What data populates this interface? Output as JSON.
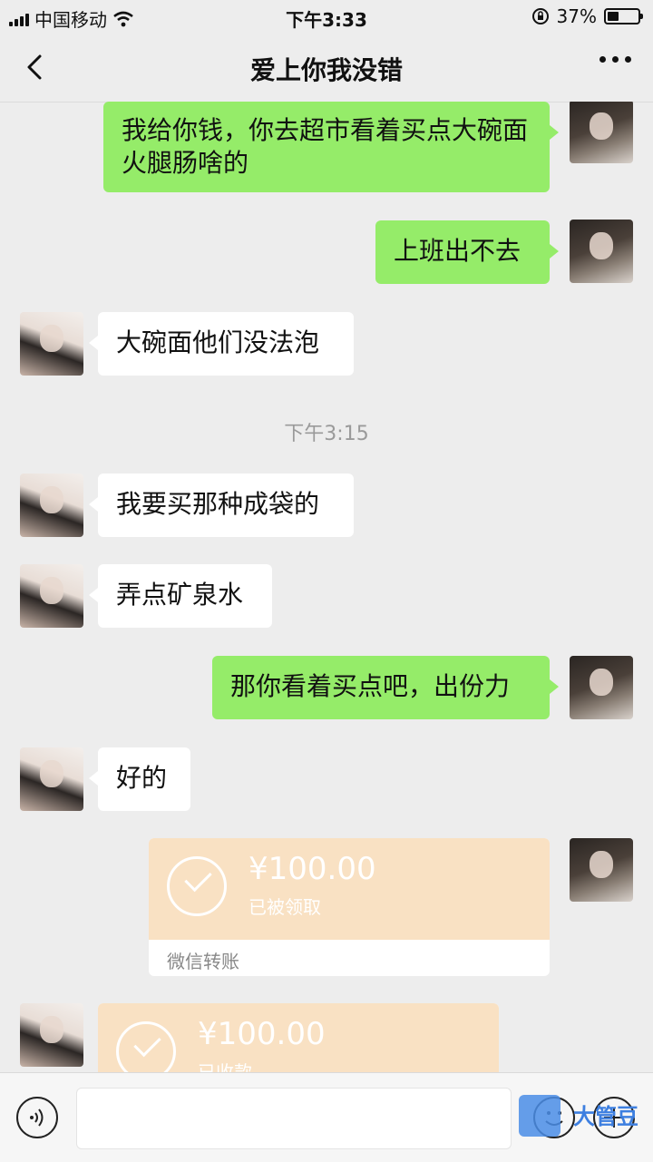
{
  "status_bar": {
    "carrier": "中国移动",
    "time": "下午3:33",
    "battery_percent": "37%",
    "battery_level": 0.37
  },
  "header": {
    "title": "爱上你我没错"
  },
  "messages": [
    {
      "side": "right",
      "text": "我给你钱，你去超市看着买点大碗面火腿肠啥的"
    },
    {
      "side": "right",
      "text": "上班出不去"
    },
    {
      "side": "left",
      "text": "大碗面他们没法泡"
    },
    {
      "side": "left",
      "text": "我要买那种成袋的"
    },
    {
      "side": "left",
      "text": "弄点矿泉水"
    },
    {
      "side": "right",
      "text": "那你看着买点吧，出份力"
    },
    {
      "side": "left",
      "text": "好的"
    }
  ],
  "timestamp": "下午3:15",
  "transfers": [
    {
      "side": "right",
      "amount": "¥100.00",
      "status": "已被领取",
      "footer": "微信转账"
    },
    {
      "side": "left",
      "amount": "¥100.00",
      "status": "已收款"
    }
  ],
  "watermark": "大管豆",
  "colors": {
    "background": "#ededed",
    "self_bubble": "#95ec69",
    "other_bubble": "#ffffff",
    "transfer": "#f9e1c3"
  }
}
